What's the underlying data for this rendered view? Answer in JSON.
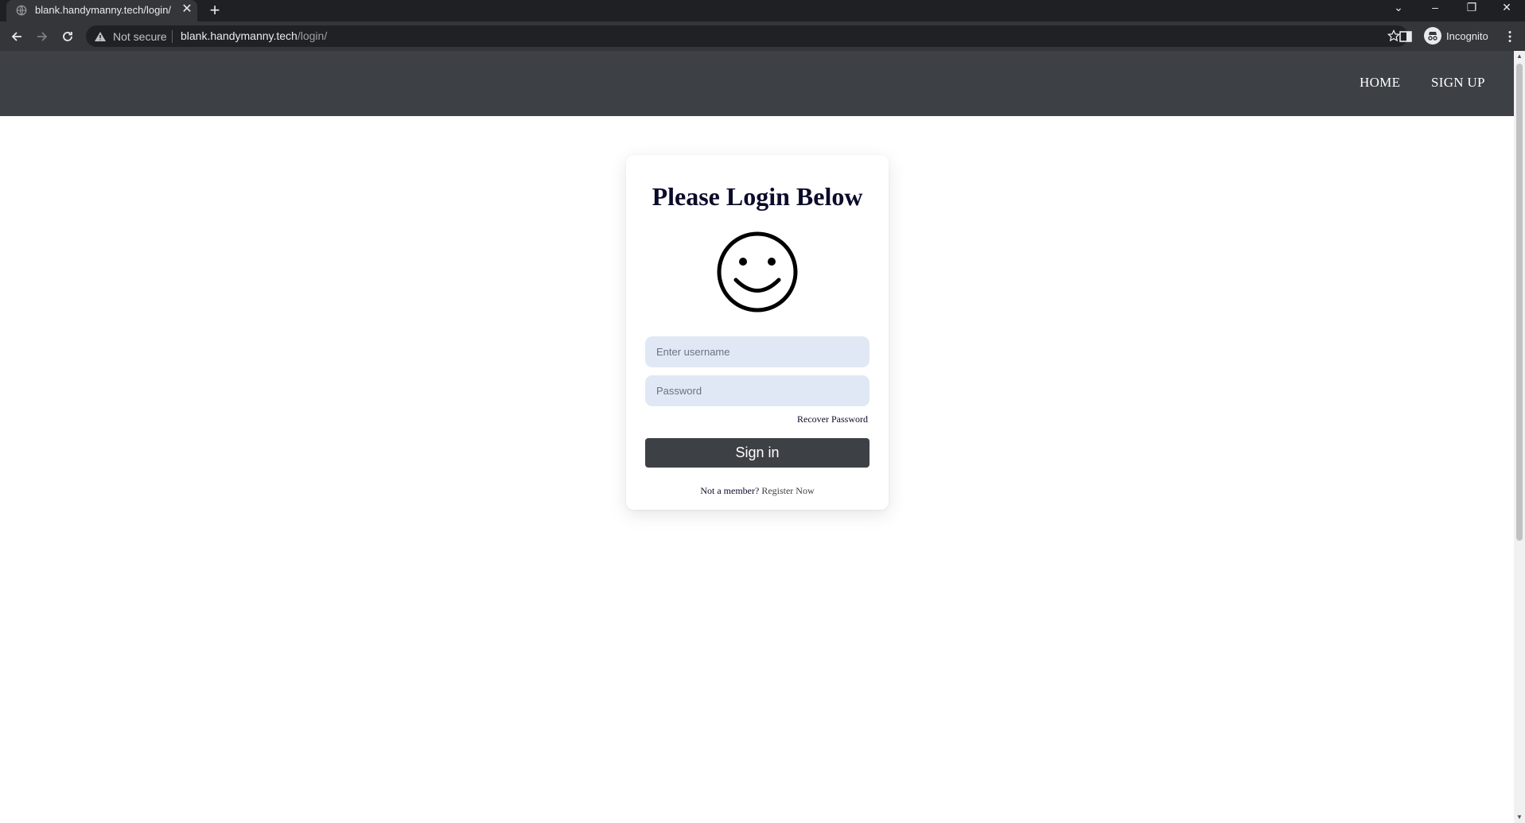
{
  "browser": {
    "tab_title": "blank.handymanny.tech/login/",
    "new_tab_symbol": "+",
    "close_symbol": "✕",
    "security_label": "Not secure",
    "url_host": "blank.handymanny.tech",
    "url_path": "/login/",
    "profile_label": "Incognito",
    "window_controls": {
      "tabs_menu": "⌄",
      "minimize": "–",
      "restore": "❐",
      "close": "✕"
    }
  },
  "site": {
    "nav": {
      "home": "HOME",
      "signup": "SIGN UP"
    },
    "login": {
      "title": "Please Login Below",
      "username_placeholder": "Enter username",
      "password_placeholder": "Password",
      "recover_link": "Recover Password",
      "submit_label": "Sign in",
      "not_member_text": "Not a member?",
      "register_link": "Register Now"
    }
  },
  "colors": {
    "navbar": "#3d4145",
    "input_bg": "#e0e8f5",
    "button_bg": "#3d4145",
    "title_text": "#0b0b2a"
  },
  "icons": [
    "globe-icon",
    "close-icon",
    "plus-icon",
    "chevron-down-icon",
    "minimize-icon",
    "restore-icon",
    "back-arrow-icon",
    "forward-arrow-icon",
    "reload-icon",
    "warning-icon",
    "star-icon",
    "side-panel-icon",
    "incognito-icon",
    "kebab-menu-icon",
    "smiley-face-icon"
  ]
}
